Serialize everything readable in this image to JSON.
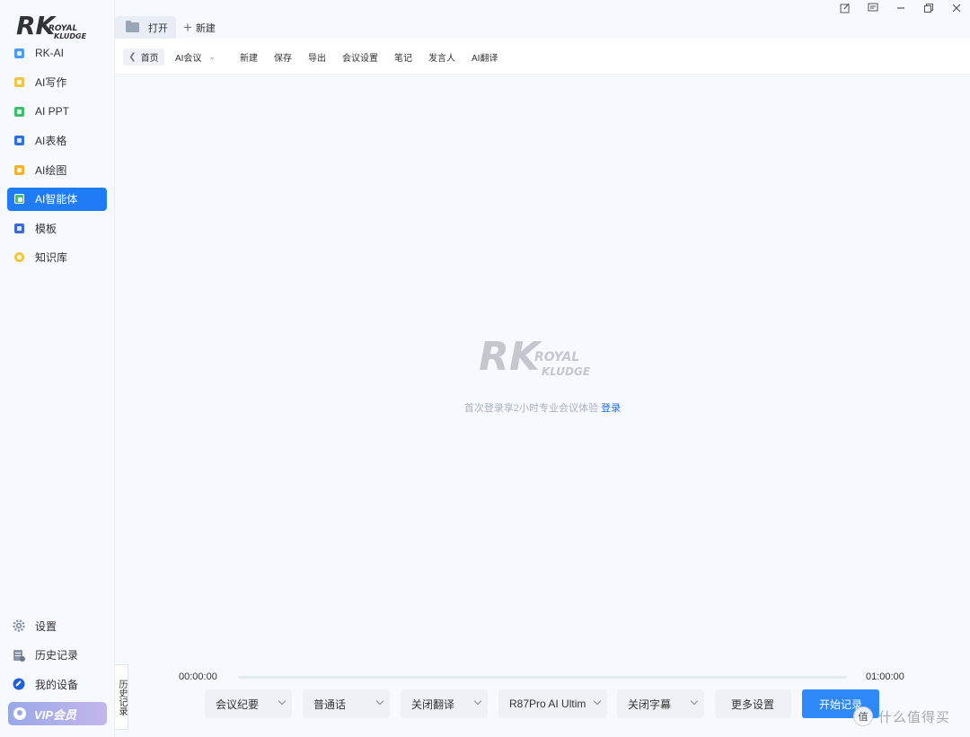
{
  "brand": {
    "logo_main": "RK",
    "logo_line1": "ROYAL",
    "logo_line2": "KLUDGE"
  },
  "sidebar": {
    "items": [
      {
        "label": "RK-AI",
        "icon": "rk-ai-icon",
        "color": "#4b9bf0"
      },
      {
        "label": "AI写作",
        "icon": "write-icon",
        "color": "#f5c24a"
      },
      {
        "label": "AI PPT",
        "icon": "ppt-icon",
        "color": "#3cbf6a"
      },
      {
        "label": "AI表格",
        "icon": "table-icon",
        "color": "#2f6fe0"
      },
      {
        "label": "AI绘图",
        "icon": "draw-icon",
        "color": "#f5b230"
      },
      {
        "label": "AI智能体",
        "icon": "agent-icon",
        "color": "#3cc27a"
      },
      {
        "label": "模板",
        "icon": "template-icon",
        "color": "#3c68d8"
      },
      {
        "label": "知识库",
        "icon": "knowledge-icon",
        "color": "#f5c23a"
      }
    ],
    "active_index": 5,
    "bottom": {
      "settings": "设置",
      "history": "历史记录",
      "devices": "我的设备",
      "vip": "VIP会员"
    }
  },
  "topbar": {
    "open_tab": "打开",
    "new_tab": "新建"
  },
  "toolbar": {
    "back": "首页",
    "meeting": "AI会议",
    "items": [
      "新建",
      "保存",
      "导出",
      "会议设置",
      "笔记",
      "发言人",
      "AI翻译"
    ]
  },
  "main": {
    "login_text": "首次登录享2小时专业会议体验",
    "login_link": "登录",
    "history_tab": "历史记录"
  },
  "player": {
    "time_start": "00:00:00",
    "time_end": "01:00:00",
    "progress": 0
  },
  "controls": {
    "summary": "会议纪要",
    "language": "普通话",
    "translate": "关闭翻译",
    "device": "R87Pro AI Ultim",
    "subtitles": "关闭字幕",
    "more": "更多设置",
    "start": "开始记录"
  },
  "watermark": {
    "badge": "值",
    "text": "什么值得买"
  },
  "colors": {
    "accent": "#1f7cf6",
    "start_button": "#2e88f5",
    "link": "#1f6fe8"
  }
}
